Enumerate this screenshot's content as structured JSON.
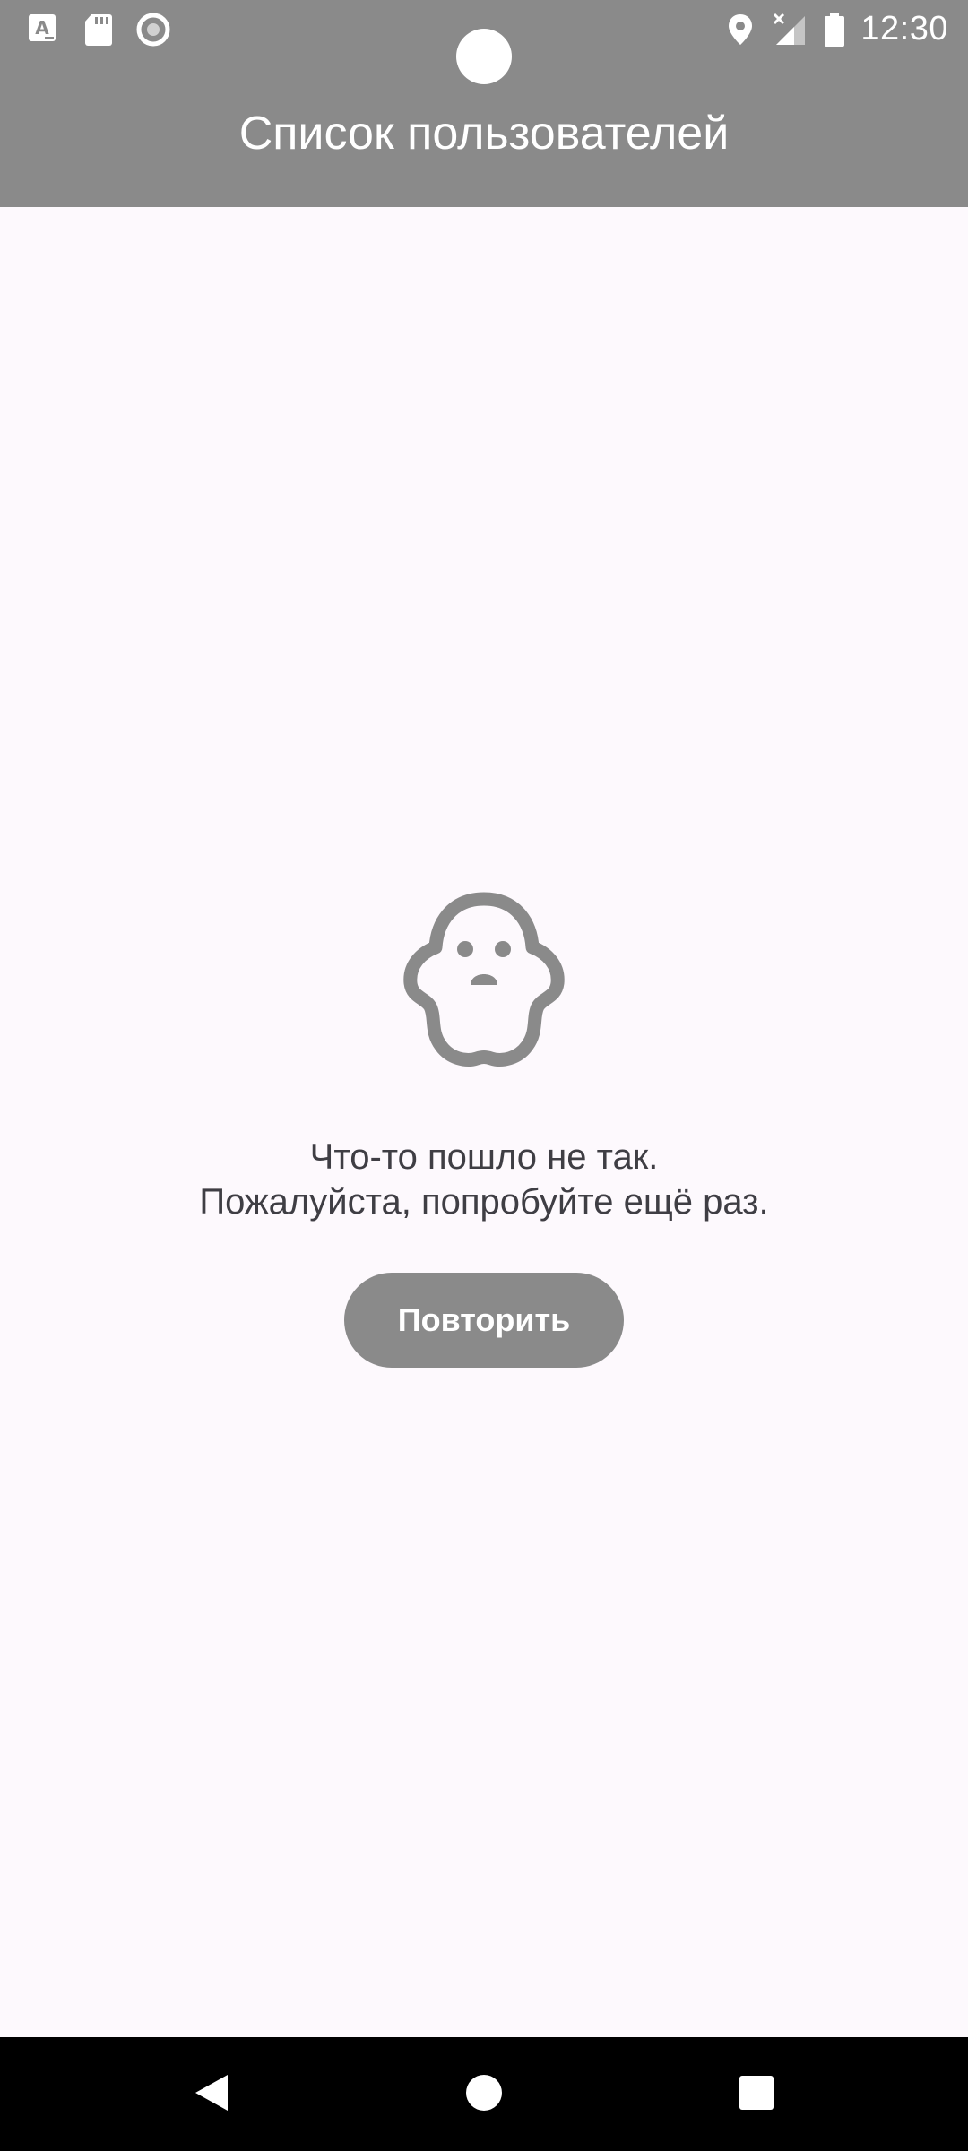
{
  "status_bar": {
    "time": "12:30",
    "left_icons": [
      "text-input-icon",
      "sd-card-icon",
      "record-icon"
    ],
    "right_icons": [
      "location-icon",
      "signal-no-data-icon",
      "battery-icon"
    ]
  },
  "app_bar": {
    "title": "Список пользователей",
    "color": "#8a8a8a"
  },
  "error_state": {
    "icon": "ghost-icon",
    "line1": "Что-то пошло не так.",
    "line2": "Пожалуйста, попробуйте ещё раз.",
    "retry_label": "Повторить"
  },
  "nav_bar": {
    "buttons": [
      "back-icon",
      "home-icon",
      "recents-icon"
    ]
  },
  "colors": {
    "accent": "#8a8a8a",
    "background": "#fdf9fd",
    "text": "#3f3e44"
  }
}
